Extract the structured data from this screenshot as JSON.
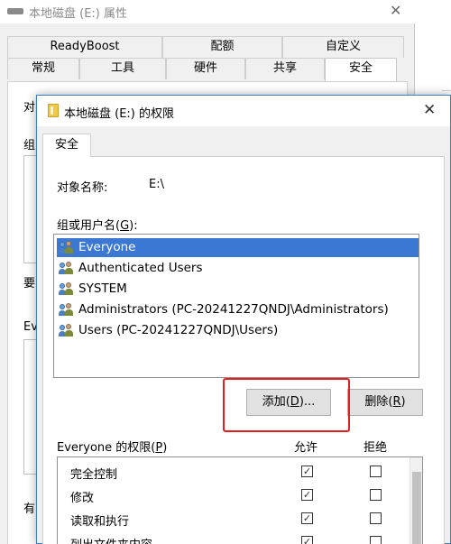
{
  "background_window": {
    "title": "本地磁盘 (E:) 属性",
    "close": "✕",
    "tabs_row1": [
      "ReadyBoost",
      "配额",
      "自定义"
    ],
    "tabs_row2": [
      "常规",
      "工具",
      "硬件",
      "共享",
      "安全"
    ],
    "selected_tab": "安全",
    "fragments": [
      "对",
      "组",
      "要",
      "Eve",
      "有"
    ]
  },
  "dialog": {
    "title": "本地磁盘 (E:) 的权限",
    "close": "✕",
    "tab": "安全",
    "object_label": "对象名称:",
    "object_value": "E:\\",
    "group_label_prefix": "组或用户名(",
    "group_label_key": "G",
    "group_label_suffix": "):",
    "users": [
      {
        "name": "Everyone",
        "selected": true
      },
      {
        "name": "Authenticated Users",
        "selected": false
      },
      {
        "name": "SYSTEM",
        "selected": false
      },
      {
        "name": "Administrators (PC-20241227QNDJ\\Administrators)",
        "selected": false
      },
      {
        "name": "Users (PC-20241227QNDJ\\Users)",
        "selected": false
      }
    ],
    "add_button": {
      "prefix": "添加(",
      "key": "D",
      "suffix": ")..."
    },
    "remove_button": {
      "prefix": "删除(",
      "key": "R",
      "suffix": ")"
    },
    "perm_label_prefix": "Everyone 的权限(",
    "perm_label_key": "P",
    "perm_label_suffix": ")",
    "allow_header": "允许",
    "deny_header": "拒绝",
    "permissions": [
      {
        "name": "完全控制",
        "allow": true,
        "deny": false
      },
      {
        "name": "修改",
        "allow": true,
        "deny": false
      },
      {
        "name": "读取和执行",
        "allow": true,
        "deny": false
      },
      {
        "name": "列出文件夹内容",
        "allow": true,
        "deny": false
      }
    ],
    "check_glyph": "✓",
    "highlight_color": "#e02020",
    "selection_color": "#3a78d4"
  }
}
